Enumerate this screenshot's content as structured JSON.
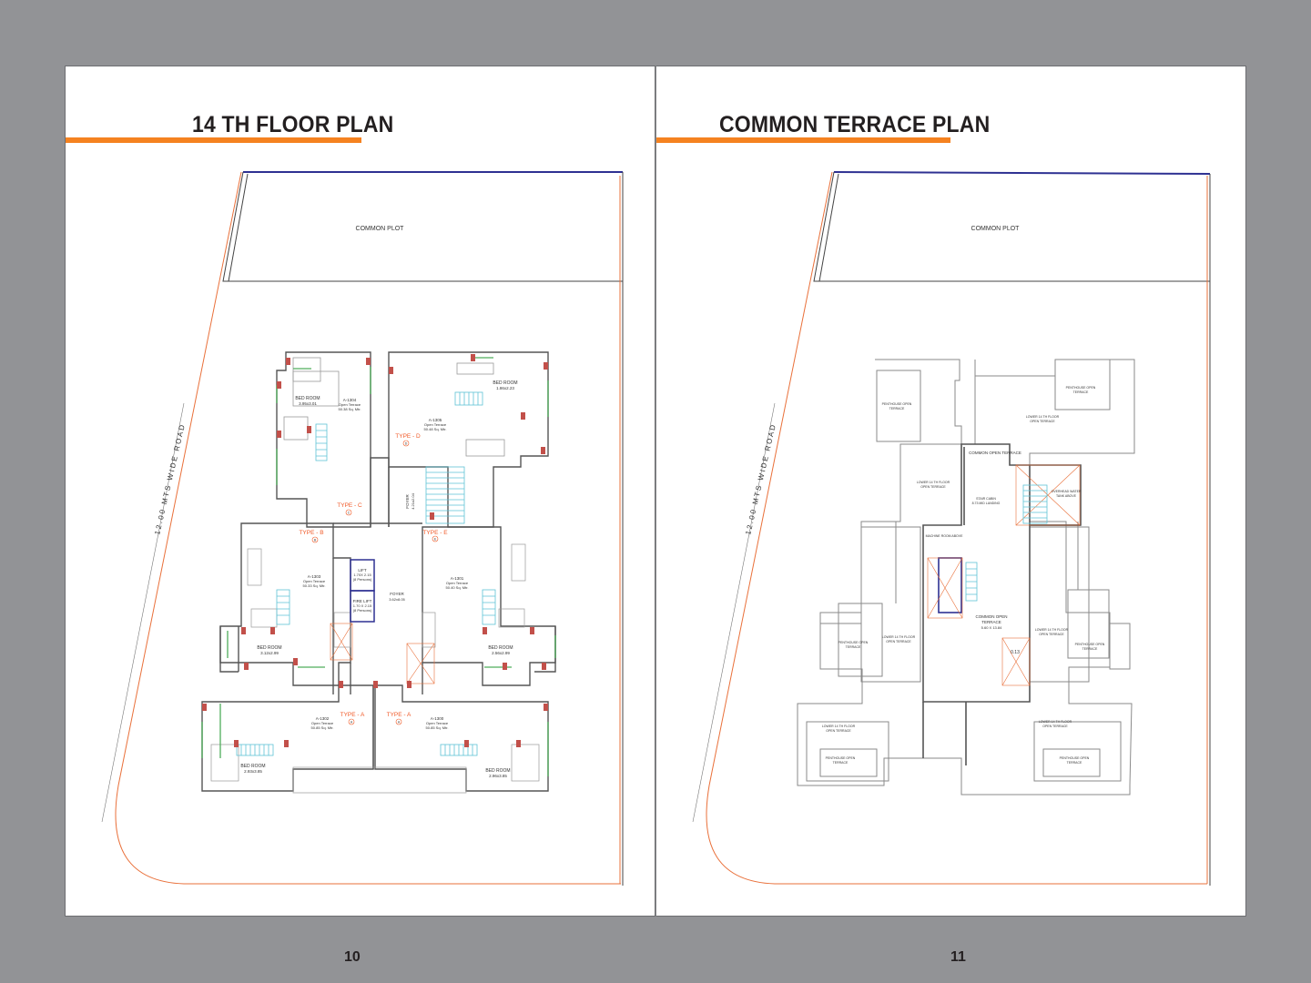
{
  "left_page": {
    "title": "14 TH FLOOR PLAN",
    "page_number": "10",
    "common_plot": "COMMON PLOT",
    "road_label": "12.00 MTS WIDE ROAD",
    "rooms": {
      "bed_c": "BED ROOM",
      "bed_c_dim": "3.95x3.01",
      "a1304": "A-1304",
      "a1304_terrace": "Open Terrace",
      "a1304_area": "50.38 Sq. Mtr.",
      "type_c": "TYPE - C",
      "type_d": "TYPE - D",
      "bed_d": "BED ROOM",
      "bed_d_dim": "1.86x2.23",
      "a1305": "A-1305",
      "a1305_terrace": "Open Terrace",
      "a1305_area": "50.48 Sq. Mtr.",
      "foyer_top": "FOYER",
      "foyer_top_dim": "4.21x2.04",
      "type_b": "TYPE - B",
      "type_e": "TYPE - E",
      "lift": "LIFT",
      "lift_dim": "1.70X 2.15",
      "lift_cap": "(8 Persons)",
      "fire_lift": "FIRE LIFT",
      "fire_lift_dim": "1.70 X 2.15",
      "fire_lift_cap": "(8 Persons)",
      "foyer_mid": "FOYER",
      "foyer_mid_dim": "3.62x8.05",
      "a1303": "A-1303",
      "a1303_terrace": "Open Terrace",
      "a1303_area": "50.33 Sq. Mtr.",
      "a1301": "A-1301",
      "a1301_terrace": "Open Terrace",
      "a1301_area": "50.40 Sq. Mtr.",
      "bed_b": "BED ROOM",
      "bed_b_dim": "3.12x2.99",
      "bed_e": "BED ROOM",
      "bed_e_dim": "2.56x2.99",
      "type_a1": "TYPE - A",
      "type_a2": "TYPE - A",
      "a1302": "A-1302",
      "a1302_terrace": "Open Terrace",
      "a1302_area": "50.85 Sq. Mtr.",
      "a1300": "A-1300",
      "a1300_terrace": "Open Terrace",
      "a1300_area": "50.85 Sq. Mtr.",
      "bed_a1": "BED ROOM",
      "bed_a1_dim": "2.93x3.85",
      "bed_a2": "BED ROOM",
      "bed_a2_dim": "2.96x3.85",
      "c_mark": "C",
      "b_mark": "B",
      "e_mark": "E",
      "d_mark": "D",
      "a1_mark": "A",
      "a2_mark": "A"
    }
  },
  "right_page": {
    "title": "COMMON TERRACE PLAN",
    "page_number": "11",
    "common_plot": "COMMON PLOT",
    "road_label": "12.00 MTS WIDE ROAD",
    "labels": {
      "common_open_terrace": "COMMON OPEN TERRACE",
      "common_open_terrace_center": "COMMON OPEN",
      "cot_center_2": "TERRACE",
      "cot_center_dim": "5.60 X 13.84",
      "ots": "0.13",
      "penthouse_top_left": "PENTHOUSE OPEN",
      "pth_tl_2": "TERRACE",
      "penthouse_top_right": "PENTHOUSE OPEN",
      "pth_tr_2": "TERRACE",
      "lower_top_right": "LOWER 14 TH FLOOR",
      "ltr_2": "OPEN TERRACE",
      "lower_top_left": "LOWER 14 TH FLOOR",
      "ltl_2": "OPEN TERRACE",
      "stair_cabin": "STAIR CABIN",
      "stair_cabin_2": "8.73 MID LANDING",
      "overhead_tank": "OVERHEAD WATER",
      "overhead_tank_2": "TANK ABOVE",
      "machine_room": "MACHINE ROOM ABOVE",
      "penthouse_mid_left": "PENTHOUSE OPEN",
      "pml_2": "TERRACE",
      "lower_mid_left": "LOWER 14 TH FLOOR",
      "lml_2": "OPEN TERRACE",
      "lower_mid_right": "LOWER 14 TH FLOOR",
      "lmr_2": "OPEN TERRACE",
      "penthouse_mid_right": "PENTHOUSE OPEN",
      "pmr_2": "TERRACE",
      "lower_bottom_left": "LOWER 14 TH FLOOR",
      "lbl_2": "OPEN TERRACE",
      "lower_bottom_right": "LOWER 14 TH FLOOR",
      "lbr_2": "OPEN TERRACE",
      "penthouse_bottom_left": "PENTHOUSE OPEN",
      "pbl_2": "TERRACE",
      "penthouse_bottom_right": "PENTHOUSE OPEN",
      "pbr_2": "TERRACE"
    }
  },
  "colors": {
    "background": "#929396",
    "accent_orange": "#f58220",
    "plot_boundary": "#e9703a",
    "wall": "#555555",
    "stair": "#5fc3d6",
    "window": "#4fae5b",
    "column": "#c2504a",
    "lift": "#2e3192"
  }
}
